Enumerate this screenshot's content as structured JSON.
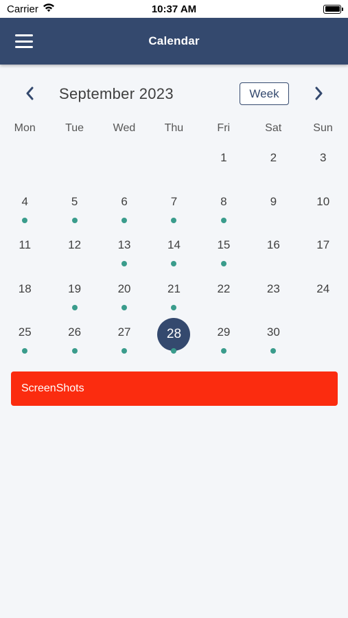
{
  "status_bar": {
    "carrier": "Carrier",
    "time": "10:37 AM"
  },
  "app_bar": {
    "title": "Calendar"
  },
  "month_header": {
    "month_label": "September 2023",
    "view_button": "Week"
  },
  "weekdays": [
    "Mon",
    "Tue",
    "Wed",
    "Thu",
    "Fri",
    "Sat",
    "Sun"
  ],
  "calendar": {
    "leading_blanks": 4,
    "days": [
      {
        "day": "1",
        "event": false
      },
      {
        "day": "2",
        "event": false
      },
      {
        "day": "3",
        "event": false
      },
      {
        "day": "4",
        "event": true
      },
      {
        "day": "5",
        "event": true
      },
      {
        "day": "6",
        "event": true
      },
      {
        "day": "7",
        "event": true
      },
      {
        "day": "8",
        "event": true
      },
      {
        "day": "9",
        "event": false
      },
      {
        "day": "10",
        "event": false
      },
      {
        "day": "11",
        "event": false
      },
      {
        "day": "12",
        "event": false
      },
      {
        "day": "13",
        "event": true
      },
      {
        "day": "14",
        "event": true
      },
      {
        "day": "15",
        "event": true
      },
      {
        "day": "16",
        "event": false
      },
      {
        "day": "17",
        "event": false
      },
      {
        "day": "18",
        "event": false
      },
      {
        "day": "19",
        "event": true
      },
      {
        "day": "20",
        "event": true
      },
      {
        "day": "21",
        "event": true
      },
      {
        "day": "22",
        "event": false
      },
      {
        "day": "23",
        "event": false
      },
      {
        "day": "24",
        "event": false
      },
      {
        "day": "25",
        "event": true
      },
      {
        "day": "26",
        "event": true
      },
      {
        "day": "27",
        "event": true
      },
      {
        "day": "28",
        "event": true,
        "selected": true
      },
      {
        "day": "29",
        "event": true
      },
      {
        "day": "30",
        "event": true
      }
    ]
  },
  "events": [
    {
      "title": "ScreenShots",
      "color": "#fb2c0f"
    }
  ],
  "colors": {
    "primary": "#34496e",
    "event_dot": "#3a9c8c",
    "event_bar": "#fb2c0f",
    "background": "#f4f6f9"
  },
  "icons": {
    "menu": "hamburger-menu-icon",
    "prev": "chevron-left-icon",
    "next": "chevron-right-icon",
    "wifi": "wifi-icon",
    "battery": "battery-icon"
  }
}
